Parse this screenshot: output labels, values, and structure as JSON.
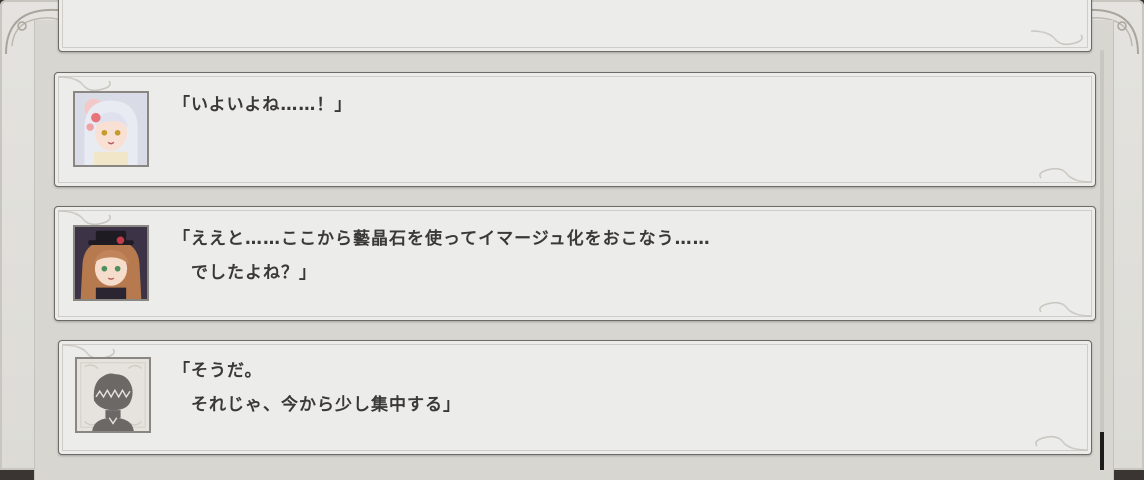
{
  "dialogue_log": {
    "entries": [
      {
        "speaker_icon": "white-haired-girl-portrait",
        "lines": [
          "「いよいよね……！」"
        ]
      },
      {
        "speaker_icon": "brown-haired-girl-with-top-hat-portrait",
        "lines": [
          "「ええと……ここから藝晶石を使ってイマージュ化をおこなう……",
          "　でしたよね？」"
        ]
      },
      {
        "speaker_icon": "silhouette-protagonist-portrait",
        "lines": [
          "「そうだ。",
          "　それじゃ、今から少し集中する」"
        ]
      }
    ]
  },
  "colors": {
    "card_bg": "#ececea",
    "text": "#3b3937",
    "frame": "#dcdbd6"
  }
}
